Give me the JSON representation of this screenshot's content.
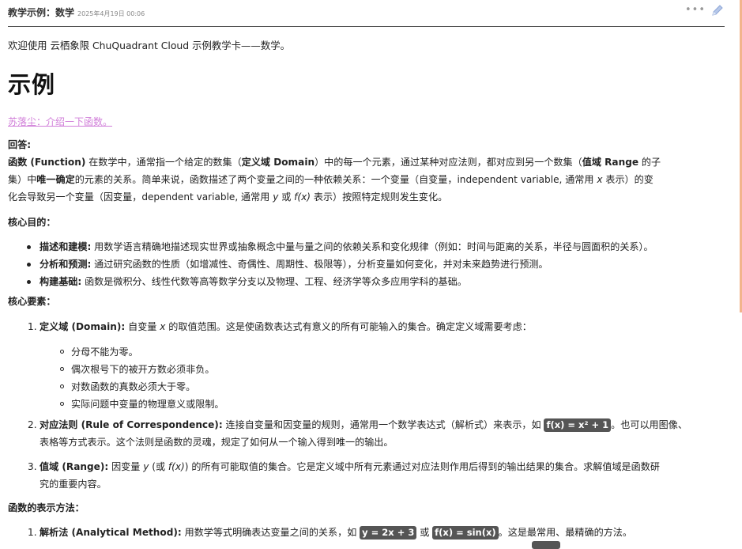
{
  "header": {
    "title": "教学示例：数学",
    "date": "2025年4月19日 00:06",
    "more_icon": "ellipsis-icon",
    "edit_icon": "pencil-icon"
  },
  "welcome": "欢迎使用 云栖象限 ChuQuadrant Cloud 示例教学卡——数学。",
  "section_title": "示例",
  "prompt_link": "苏落尘：介绍一下函数。",
  "answer_label": "回答:",
  "intro": {
    "line1_a": "函数 (Function)",
    "line1_b": " 在数学中，通常指一个给定的数集（",
    "line1_c": "定义域 Domain",
    "line1_d": "）中的每一个元素，通过某种对应法则，都对应到另一个数集（",
    "line1_e": "值域 Range",
    "line1_f": " 的子",
    "line2_a": "集）中",
    "line2_b": "唯一确定",
    "line2_c": "的元素的关系。简单来说，函数描述了两个变量之间的一种依赖关系：一个变量（自变量，independent variable, 通常用 ",
    "line2_x": "x",
    "line2_d": " 表示）的变",
    "line3_a": "化会导致另一个变量（因变量，dependent variable, 通常用 ",
    "line3_y": "y",
    "line3_b": " 或 ",
    "line3_fx": "f(x)",
    "line3_c": " 表示）按照特定规则发生变化。"
  },
  "purpose": {
    "heading": "核心目的：",
    "items": [
      {
        "label": "描述和建模:",
        "text": " 用数学语言精确地描述现实世界或抽象概念中量与量之间的依赖关系和变化规律（例如：时间与距离的关系，半径与圆面积的关系）。"
      },
      {
        "label": "分析和预测:",
        "text": " 通过研究函数的性质（如增减性、奇偶性、周期性、极限等），分析变量如何变化，并对未来趋势进行预测。"
      },
      {
        "label": "构建基础:",
        "text": " 函数是微积分、线性代数等高等数学分支以及物理、工程、经济学等众多应用学科的基础。"
      }
    ]
  },
  "elements": {
    "heading": "核心要素：",
    "domain": {
      "num": "1.",
      "label": "定义域 (Domain):",
      "text_a": " 自变量 ",
      "x": "x",
      "text_b": " 的取值范围。这是使函数表达式有意义的所有可能输入的集合。确定定义域需要考虑：",
      "subs": [
        "分母不能为零。",
        "偶次根号下的被开方数必须非负。",
        "对数函数的真数必须大于零。",
        "实际问题中变量的物理意义或限制。"
      ]
    },
    "rule": {
      "num": "2.",
      "label": "对应法则 (Rule of Correspondence):",
      "text_a": " 连接自变量和因变量的规则，通常用一个数学表达式（解析式）来表示，如 ",
      "math": "f(x) = x² + 1",
      "text_b": "。也可以用图像、",
      "line2": "表格等方式表示。这个法则是函数的灵魂，规定了如何从一个输入得到唯一的输出。"
    },
    "range": {
      "num": "3.",
      "label": "值域 (Range):",
      "text_a": " 因变量 ",
      "y": "y",
      "text_b": " (或 ",
      "fx": "f(x)",
      "text_c": ") 的所有可能取值的集合。它是定义域中所有元素通过对应法则作用后得到的输出结果的集合。求解值域是函数研",
      "line2": "究的重要内容。"
    }
  },
  "representation": {
    "heading": "函数的表示方法：",
    "analytical": {
      "num": "1.",
      "label": "解析法 (Analytical Method):",
      "text_a": " 用数学等式明确表达变量之间的关系，如 ",
      "math1": "y = 2x + 3",
      "text_or": " 或 ",
      "math2": "f(x) = sin(x)",
      "text_b": "。这是最常用、最精确的方法。"
    }
  },
  "colors": {
    "link": "#d17fd9",
    "accent": "#f2b48c",
    "math_bg": "#555555"
  }
}
